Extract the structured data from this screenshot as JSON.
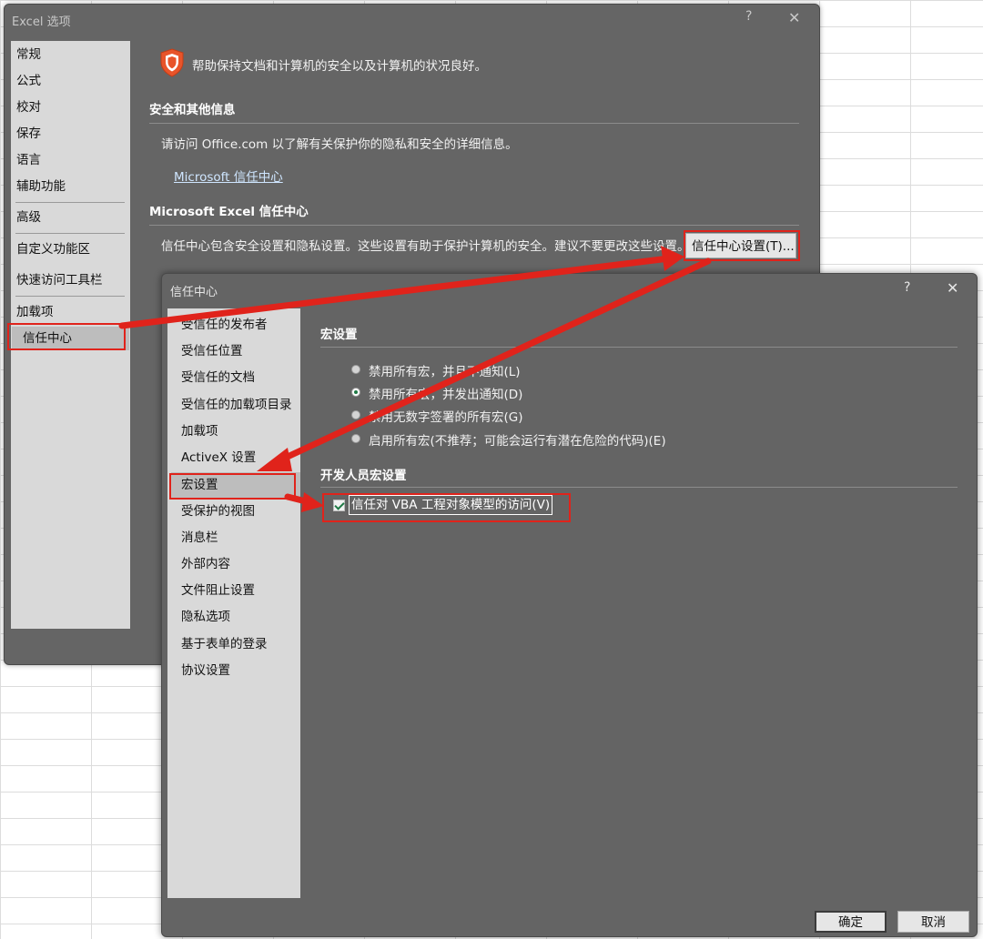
{
  "excel_options": {
    "title": "Excel 选项",
    "help_glyph": "?",
    "close_glyph": "✕",
    "nav": {
      "general": "常规",
      "formulas": "公式",
      "proofing": "校对",
      "save": "保存",
      "language": "语言",
      "accessibility": "辅助功能",
      "advanced": "高级",
      "customize_ribbon": "自定义功能区",
      "quick_access_toolbar": "快速访问工具栏",
      "addins": "加载项",
      "trust_center": "信任中心"
    },
    "main": {
      "intro": "帮助保持文档和计算机的安全以及计算机的状况良好。",
      "section_security": "安全和其他信息",
      "security_text": "请访问 Office.com 以了解有关保护你的隐私和安全的详细信息。",
      "ms_trust_center_link": "Microsoft 信任中心",
      "section_excel_trust": "Microsoft Excel 信任中心",
      "excel_trust_text": "信任中心包含安全设置和隐私设置。这些设置有助于保护计算机的安全。建议不要更改这些设置。",
      "trust_center_settings_button": "信任中心设置(T)..."
    }
  },
  "trust_center": {
    "title": "信任中心",
    "help_glyph": "?",
    "close_glyph": "✕",
    "nav": {
      "trusted_publishers": "受信任的发布者",
      "trusted_locations": "受信任位置",
      "trusted_documents": "受信任的文档",
      "trusted_addin_catalogs": "受信任的加载项目录",
      "addins": "加载项",
      "activex": "ActiveX 设置",
      "macro_settings": "宏设置",
      "protected_view": "受保护的视图",
      "message_bar": "消息栏",
      "external_content": "外部内容",
      "file_block": "文件阻止设置",
      "privacy": "隐私选项",
      "form_signin": "基于表单的登录",
      "protocol": "协议设置"
    },
    "macro": {
      "section_title": "宏设置",
      "options": [
        {
          "label": "禁用所有宏，并且不通知(L)",
          "selected": false
        },
        {
          "label": "禁用所有宏，并发出通知(D)",
          "selected": true
        },
        {
          "label": "禁用无数字签署的所有宏(G)",
          "selected": false
        },
        {
          "label": "启用所有宏(不推荐；可能会运行有潜在危险的代码)(E)",
          "selected": false
        }
      ],
      "developer_title": "开发人员宏设置",
      "vba_trust_label": "信任对 VBA 工程对象模型的访问(V)",
      "vba_trust_checked": true
    },
    "buttons": {
      "ok": "确定",
      "cancel": "取消"
    }
  },
  "colors": {
    "highlight_red": "#e0231b",
    "shield_orange": "#e8542a",
    "checkbox_green": "#1f7a45"
  }
}
